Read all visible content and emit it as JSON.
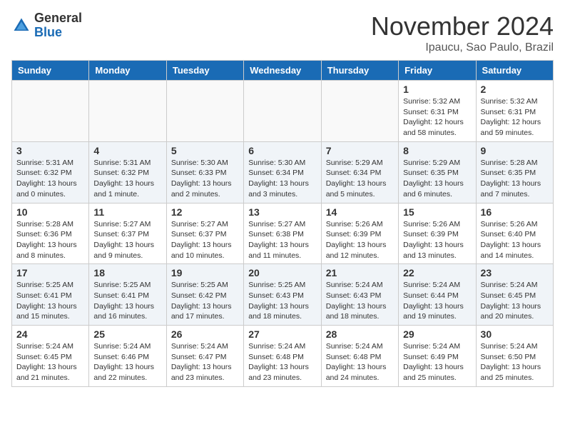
{
  "logo": {
    "general": "General",
    "blue": "Blue"
  },
  "title": "November 2024",
  "location": "Ipaucu, Sao Paulo, Brazil",
  "weekdays": [
    "Sunday",
    "Monday",
    "Tuesday",
    "Wednesday",
    "Thursday",
    "Friday",
    "Saturday"
  ],
  "rows": [
    [
      {
        "day": "",
        "info": ""
      },
      {
        "day": "",
        "info": ""
      },
      {
        "day": "",
        "info": ""
      },
      {
        "day": "",
        "info": ""
      },
      {
        "day": "",
        "info": ""
      },
      {
        "day": "1",
        "info": "Sunrise: 5:32 AM\nSunset: 6:31 PM\nDaylight: 12 hours and 58 minutes."
      },
      {
        "day": "2",
        "info": "Sunrise: 5:32 AM\nSunset: 6:31 PM\nDaylight: 12 hours and 59 minutes."
      }
    ],
    [
      {
        "day": "3",
        "info": "Sunrise: 5:31 AM\nSunset: 6:32 PM\nDaylight: 13 hours and 0 minutes."
      },
      {
        "day": "4",
        "info": "Sunrise: 5:31 AM\nSunset: 6:32 PM\nDaylight: 13 hours and 1 minute."
      },
      {
        "day": "5",
        "info": "Sunrise: 5:30 AM\nSunset: 6:33 PM\nDaylight: 13 hours and 2 minutes."
      },
      {
        "day": "6",
        "info": "Sunrise: 5:30 AM\nSunset: 6:34 PM\nDaylight: 13 hours and 3 minutes."
      },
      {
        "day": "7",
        "info": "Sunrise: 5:29 AM\nSunset: 6:34 PM\nDaylight: 13 hours and 5 minutes."
      },
      {
        "day": "8",
        "info": "Sunrise: 5:29 AM\nSunset: 6:35 PM\nDaylight: 13 hours and 6 minutes."
      },
      {
        "day": "9",
        "info": "Sunrise: 5:28 AM\nSunset: 6:35 PM\nDaylight: 13 hours and 7 minutes."
      }
    ],
    [
      {
        "day": "10",
        "info": "Sunrise: 5:28 AM\nSunset: 6:36 PM\nDaylight: 13 hours and 8 minutes."
      },
      {
        "day": "11",
        "info": "Sunrise: 5:27 AM\nSunset: 6:37 PM\nDaylight: 13 hours and 9 minutes."
      },
      {
        "day": "12",
        "info": "Sunrise: 5:27 AM\nSunset: 6:37 PM\nDaylight: 13 hours and 10 minutes."
      },
      {
        "day": "13",
        "info": "Sunrise: 5:27 AM\nSunset: 6:38 PM\nDaylight: 13 hours and 11 minutes."
      },
      {
        "day": "14",
        "info": "Sunrise: 5:26 AM\nSunset: 6:39 PM\nDaylight: 13 hours and 12 minutes."
      },
      {
        "day": "15",
        "info": "Sunrise: 5:26 AM\nSunset: 6:39 PM\nDaylight: 13 hours and 13 minutes."
      },
      {
        "day": "16",
        "info": "Sunrise: 5:26 AM\nSunset: 6:40 PM\nDaylight: 13 hours and 14 minutes."
      }
    ],
    [
      {
        "day": "17",
        "info": "Sunrise: 5:25 AM\nSunset: 6:41 PM\nDaylight: 13 hours and 15 minutes."
      },
      {
        "day": "18",
        "info": "Sunrise: 5:25 AM\nSunset: 6:41 PM\nDaylight: 13 hours and 16 minutes."
      },
      {
        "day": "19",
        "info": "Sunrise: 5:25 AM\nSunset: 6:42 PM\nDaylight: 13 hours and 17 minutes."
      },
      {
        "day": "20",
        "info": "Sunrise: 5:25 AM\nSunset: 6:43 PM\nDaylight: 13 hours and 18 minutes."
      },
      {
        "day": "21",
        "info": "Sunrise: 5:24 AM\nSunset: 6:43 PM\nDaylight: 13 hours and 18 minutes."
      },
      {
        "day": "22",
        "info": "Sunrise: 5:24 AM\nSunset: 6:44 PM\nDaylight: 13 hours and 19 minutes."
      },
      {
        "day": "23",
        "info": "Sunrise: 5:24 AM\nSunset: 6:45 PM\nDaylight: 13 hours and 20 minutes."
      }
    ],
    [
      {
        "day": "24",
        "info": "Sunrise: 5:24 AM\nSunset: 6:45 PM\nDaylight: 13 hours and 21 minutes."
      },
      {
        "day": "25",
        "info": "Sunrise: 5:24 AM\nSunset: 6:46 PM\nDaylight: 13 hours and 22 minutes."
      },
      {
        "day": "26",
        "info": "Sunrise: 5:24 AM\nSunset: 6:47 PM\nDaylight: 13 hours and 23 minutes."
      },
      {
        "day": "27",
        "info": "Sunrise: 5:24 AM\nSunset: 6:48 PM\nDaylight: 13 hours and 23 minutes."
      },
      {
        "day": "28",
        "info": "Sunrise: 5:24 AM\nSunset: 6:48 PM\nDaylight: 13 hours and 24 minutes."
      },
      {
        "day": "29",
        "info": "Sunrise: 5:24 AM\nSunset: 6:49 PM\nDaylight: 13 hours and 25 minutes."
      },
      {
        "day": "30",
        "info": "Sunrise: 5:24 AM\nSunset: 6:50 PM\nDaylight: 13 hours and 25 minutes."
      }
    ]
  ]
}
